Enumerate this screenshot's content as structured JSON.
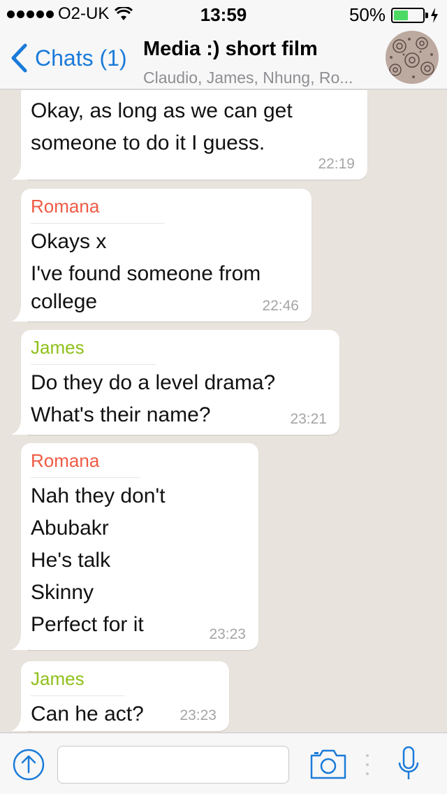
{
  "status_bar": {
    "carrier": "O2-UK",
    "time": "13:59",
    "battery": "50%",
    "battery_level": 0.5,
    "signal_icon": "signal-dots-icon",
    "wifi_icon": "wifi-icon",
    "charging_icon": "bolt-icon"
  },
  "nav": {
    "back_label": "Chats (1)",
    "title": "Media :) short film",
    "subtitle": "Claudio, James, Nhung, Ro...",
    "accent": "#1a7bd9"
  },
  "messages": [
    {
      "sender": "",
      "lines": [
        "Okay, as long as we can get",
        "someone to do it I guess."
      ],
      "time": "22:19"
    },
    {
      "sender": "Romana",
      "sender_color": "#ef5a44",
      "lines": [
        "Okays x",
        "I've found someone from",
        "college"
      ],
      "time": "22:46"
    },
    {
      "sender": "James",
      "sender_color": "#8fc01a",
      "lines": [
        "Do they do a level drama?",
        "What's their name?"
      ],
      "time": "23:21"
    },
    {
      "sender": "Romana",
      "sender_color": "#ef5a44",
      "lines": [
        "Nah they don't",
        "Abubakr",
        "He's talk",
        "Skinny",
        "Perfect for it"
      ],
      "time": "23:23"
    },
    {
      "sender": "James",
      "sender_color": "#8fc01a",
      "lines": [
        "Can he act?"
      ],
      "time": "23:23"
    }
  ],
  "input": {
    "placeholder": "",
    "attach_icon": "upload-arrow-icon",
    "camera_icon": "camera-icon",
    "mic_icon": "microphone-icon"
  }
}
